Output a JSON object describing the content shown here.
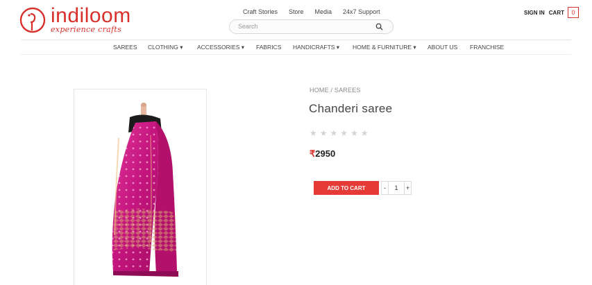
{
  "brand": {
    "name": "indiloom",
    "tagline": "experience crafts",
    "color": "#d9302c"
  },
  "top_links": [
    "Craft Stories",
    "Store",
    "Media",
    "24x7 Support"
  ],
  "search": {
    "placeholder": "Search",
    "icon": "search-icon"
  },
  "account": {
    "signin_label": "SIGN IN",
    "cart_label": "CART",
    "cart_count": "0"
  },
  "nav": {
    "items": [
      {
        "label": "SAREES"
      },
      {
        "label": "CLOTHING ▾"
      },
      {
        "label": "ACCESSORIES ▾"
      },
      {
        "label": "FABRICS"
      },
      {
        "label": "HANDICRAFTS ▾"
      },
      {
        "label": "HOME & FURNITURE ▾"
      },
      {
        "label": "ABOUT US"
      },
      {
        "label": "FRANCHISE"
      }
    ]
  },
  "product": {
    "breadcrumb": "HOME / SAREES",
    "title": "Chanderi saree",
    "rating": 0,
    "rating_max": 6,
    "price_symbol": "₹",
    "price": "2950",
    "add_to_cart_label": "ADD TO CART",
    "qty_minus": "-",
    "qty_value": "1",
    "qty_plus": "+",
    "accent_color": "#e53a35",
    "image_subject": "pink chanderi saree draped on mannequin"
  }
}
